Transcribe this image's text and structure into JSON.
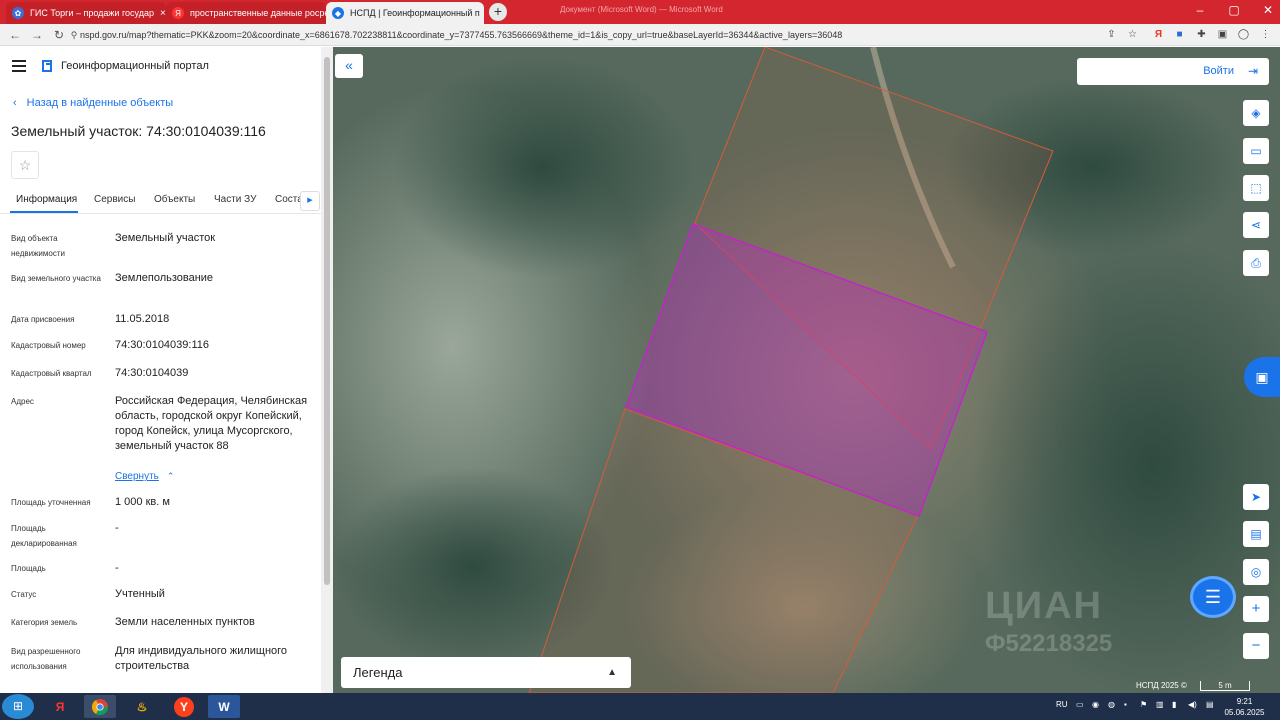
{
  "browser": {
    "tabs": [
      {
        "title": "ГИС Торги – продажи государ",
        "state": "inactive"
      },
      {
        "title": "пространственные данные росре",
        "state": "inactive"
      },
      {
        "title": "НСПД | Геоинформационный п",
        "state": "active"
      }
    ],
    "background_title": "Документ (Microsoft Word) — Microsoft Word",
    "url": "nspd.gov.ru/map?thematic=PKK&zoom=20&coordinate_x=6861678.702238811&coordinate_y=7377455.763566669&theme_id=1&is_copy_url=true&baseLayerId=36344&active_layers=36048"
  },
  "portal": {
    "title": "Геоинформационный портал",
    "back_label": "Назад в найденные объекты",
    "object_title": "Земельный участок: 74:30:0104039:116"
  },
  "tabs": [
    "Информация",
    "Сервисы",
    "Объекты",
    "Части ЗУ",
    "Соста"
  ],
  "fields": [
    {
      "label": "Вид объекта недвижимости",
      "value": "Земельный участок"
    },
    {
      "label": "Вид земельного участка",
      "value": "Землепользование"
    },
    {
      "label": "Дата присвоения",
      "value": "11.05.2018"
    },
    {
      "label": "Кадастровый номер",
      "value": "74:30:0104039:116"
    },
    {
      "label": "Кадастровый квартал",
      "value": "74:30:0104039"
    },
    {
      "label": "Адрес",
      "value": "Российская Федерация, Челябинская область, городской округ Копейский, город Копейск, улица Мусоргского, земельный участок 88"
    },
    {
      "label": "Площадь уточненная",
      "value": "1 000 кв. м"
    },
    {
      "label": "Площадь декларированная",
      "value": "-"
    },
    {
      "label": "Площадь",
      "value": "-"
    },
    {
      "label": "Статус",
      "value": "Учтенный"
    },
    {
      "label": "Категория земель",
      "value": "Земли населенных пунктов"
    },
    {
      "label": "Вид разрешенного использования",
      "value": "Для индивидуального жилищного строительства"
    }
  ],
  "collapse_label": "Свернуть",
  "map": {
    "login_label": "Войти",
    "legend_label": "Легенда",
    "footer": "НСПД 2025 ©",
    "scale": "5 m",
    "watermark_1": "ЦИАН",
    "watermark_2": "Ф52218325",
    "parcel_color": "#c026c6",
    "neighbour_color": "#d65a3a"
  },
  "taskbar": {
    "lang": "RU",
    "time": "9:21",
    "date": "05.06.2025"
  }
}
